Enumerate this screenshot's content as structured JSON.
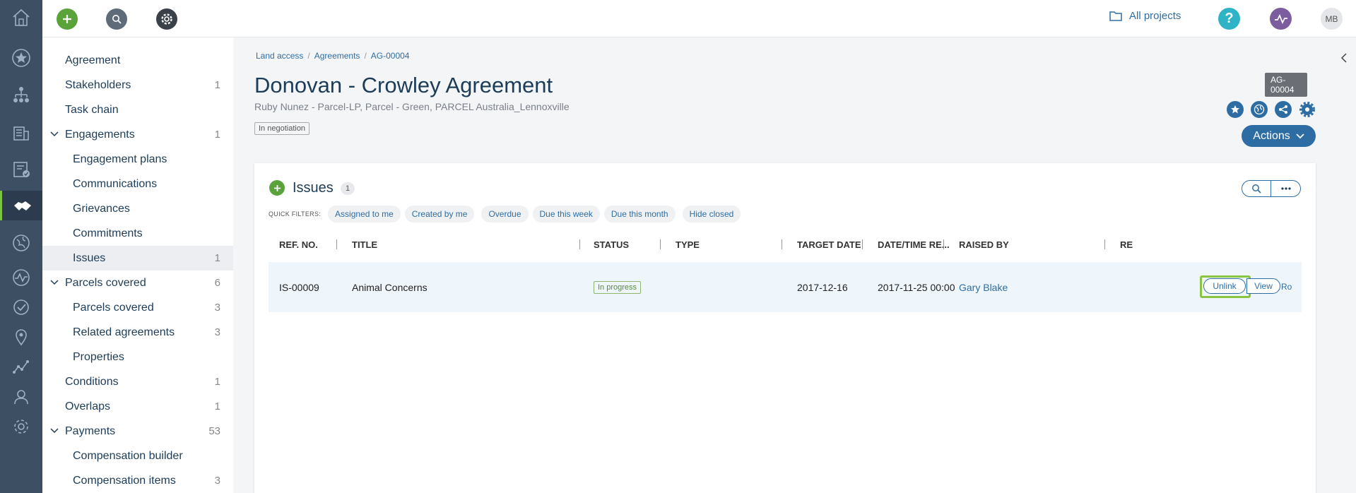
{
  "topbar": {
    "all_projects": "All projects",
    "help": "?",
    "avatar": "MB"
  },
  "rail": {
    "icons": [
      "home-icon",
      "star-icon",
      "org-chart-icon",
      "building-icon",
      "checklist-icon",
      "handshake-icon",
      "globe-icon",
      "activity-icon",
      "check-circle-icon",
      "location-icon",
      "trend-icon",
      "user-icon",
      "gear-icon"
    ]
  },
  "subnav": {
    "items": [
      {
        "label": "Agreement",
        "count": ""
      },
      {
        "label": "Stakeholders",
        "count": "1"
      },
      {
        "label": "Task chain",
        "count": ""
      },
      {
        "label": "Engagements",
        "count": "1"
      },
      {
        "label": "Engagement plans",
        "count": ""
      },
      {
        "label": "Communications",
        "count": ""
      },
      {
        "label": "Grievances",
        "count": ""
      },
      {
        "label": "Commitments",
        "count": ""
      },
      {
        "label": "Issues",
        "count": "1"
      },
      {
        "label": "Parcels covered",
        "count": "6"
      },
      {
        "label": "Parcels covered",
        "count": "3"
      },
      {
        "label": "Related agreements",
        "count": "3"
      },
      {
        "label": "Properties",
        "count": ""
      },
      {
        "label": "Conditions",
        "count": "1"
      },
      {
        "label": "Overlaps",
        "count": "1"
      },
      {
        "label": "Payments",
        "count": "53"
      },
      {
        "label": "Compensation builder",
        "count": ""
      },
      {
        "label": "Compensation items",
        "count": "3"
      }
    ]
  },
  "breadcrumb": [
    "Land access",
    "Agreements",
    "AG-00004"
  ],
  "page": {
    "title": "Donovan - Crowley Agreement",
    "subtitle": "Ruby Nunez - Parcel-LP, Parcel - Green, PARCEL Australia_Lennoxville",
    "status": "In negotiation",
    "ref": "AG-00004",
    "actions": "Actions"
  },
  "issues": {
    "title": "Issues",
    "count": "1",
    "quick_filters_label": "QUICK FILTERS:",
    "quick_filters": [
      "Assigned to me",
      "Created by me",
      "Overdue",
      "Due this week",
      "Due this month",
      "Hide closed"
    ],
    "columns": [
      "REF. NO.",
      "TITLE",
      "STATUS",
      "TYPE",
      "TARGET DATE",
      "DATE/TIME RE...",
      "RAISED BY",
      "RE"
    ],
    "rows": [
      {
        "ref": "IS-00009",
        "title": "Animal Concerns",
        "status": "In progress",
        "type": "",
        "target_date": "2017-12-16",
        "datetime": "2017-11-25 00:00",
        "raised_by": "Gary Blake",
        "unlink": "Unlink",
        "view": "View",
        "extra": "Ro"
      }
    ]
  },
  "colors": {
    "rail": "#3d4f63",
    "accent": "#2e6da4",
    "green": "#5aa33b",
    "highlight": "#8ac541"
  }
}
